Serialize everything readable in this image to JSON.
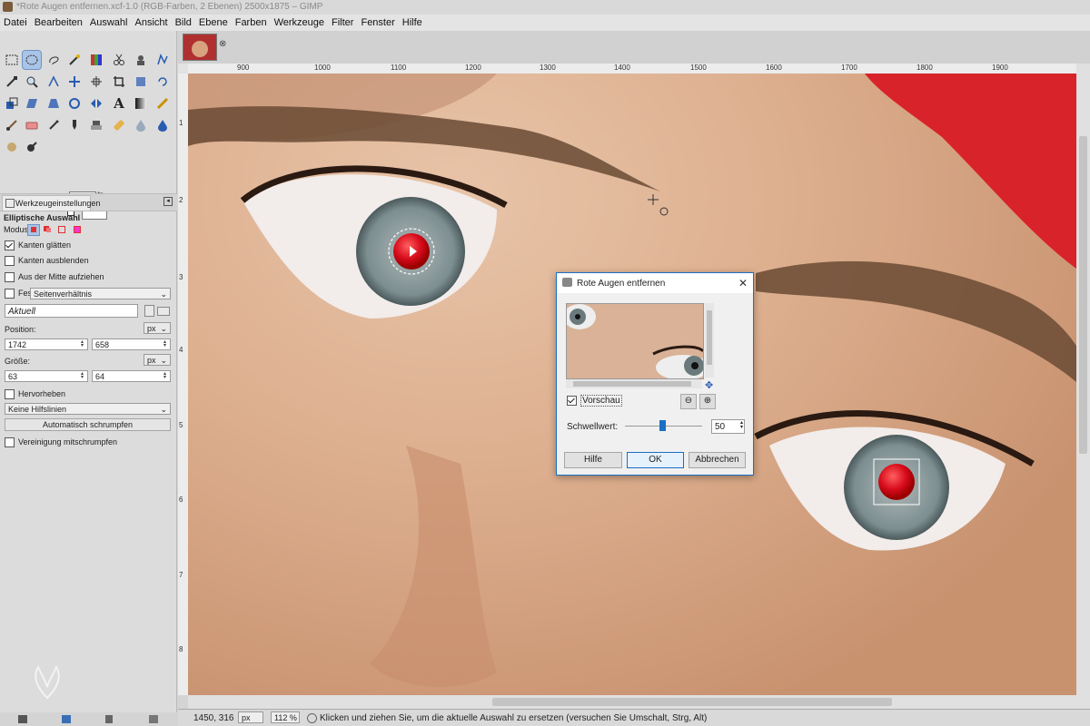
{
  "window": {
    "title": "*Rote Augen entfernen.xcf-1.0 (RGB-Farben, 2 Ebenen) 2500x1875 – GIMP"
  },
  "menu": [
    "Datei",
    "Bearbeiten",
    "Auswahl",
    "Ansicht",
    "Bild",
    "Ebene",
    "Farben",
    "Werkzeuge",
    "Filter",
    "Fenster",
    "Hilfe"
  ],
  "tool_options": {
    "tab_label": "Werkzeugeinstellungen",
    "tool_name": "Elliptische Auswahl",
    "mode_label": "Modus:",
    "antialias_label": "Kanten glätten",
    "feather_label": "Kanten ausblenden",
    "expand_center_label": "Aus der Mitte aufziehen",
    "fixed_label": "Fest",
    "fixed_value": "Seitenverhältnis",
    "aspect_value": "Aktuell",
    "position_label": "Position:",
    "position_unit": "px",
    "position_x": "1742",
    "position_y": "658",
    "size_label": "Größe:",
    "size_unit": "px",
    "size_w": "63",
    "size_h": "64",
    "highlight_label": "Hervorheben",
    "guides_value": "Keine Hilfslinien",
    "autoshrink_label": "Automatisch schrumpfen",
    "shrink_merged_label": "Vereinigung mitschrumpfen"
  },
  "ruler": [
    "900",
    "1000",
    "1100",
    "1200",
    "1300",
    "1400",
    "1500",
    "1600",
    "1700",
    "1800",
    "1900"
  ],
  "ruler_left": [
    "1",
    "2",
    "3",
    "4",
    "5",
    "6",
    "7",
    "8",
    "9"
  ],
  "status": {
    "coords": "1450, 316",
    "unit": "px",
    "zoom": "112 %",
    "message": "Klicken und ziehen Sie, um die aktuelle Auswahl zu ersetzen (versuchen Sie Umschalt, Strg, Alt)"
  },
  "dialog": {
    "title": "Rote Augen entfernen",
    "preview_label": "Vorschau",
    "threshold_label": "Schwellwert:",
    "threshold_value": "50",
    "help_label": "Hilfe",
    "ok_label": "OK",
    "cancel_label": "Abbrechen"
  },
  "colors": {
    "accent": "#1a6fc4",
    "foreground": "#111111",
    "background": "#ffffff"
  }
}
